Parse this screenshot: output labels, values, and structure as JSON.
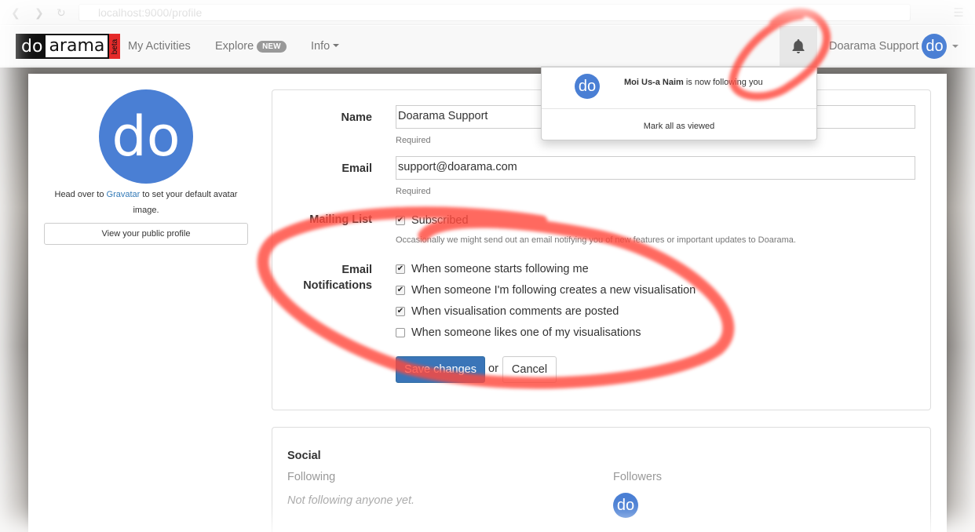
{
  "browser": {
    "url": "localhost:9000/profile"
  },
  "navbar": {
    "logo_left": "do",
    "logo_right": "arama",
    "logo_badge": "beta",
    "links": {
      "my_activities": "My Activities",
      "explore": "Explore",
      "explore_badge": "NEW",
      "info": "Info"
    },
    "user_name": "Doarama Support",
    "user_avatar_text": "do"
  },
  "notifications": {
    "items": [
      {
        "avatar_text": "do",
        "actor": "Moi Us-a Naim",
        "message": " is now following you"
      }
    ],
    "mark_all": "Mark all as viewed"
  },
  "profile": {
    "avatar_text": "do",
    "avatar_hint_before": "Head over to ",
    "avatar_hint_link": "Gravatar",
    "avatar_hint_after": " to set your default avatar image.",
    "public_profile_button": "View your public profile"
  },
  "form": {
    "name_label": "Name",
    "name_value": "Doarama Support",
    "name_help": "Required",
    "email_label": "Email",
    "email_value": "support@doarama.com",
    "email_help": "Required",
    "mailing_label": "Mailing List",
    "mailing_option": "Subscribed",
    "mailing_help": "Occasionally we might send out an email notifying you of new features or important updates to Doarama.",
    "notifications_label_line1": "Email",
    "notifications_label_line2": "Notifications",
    "notification_options": [
      {
        "label": "When someone starts following me",
        "checked": true
      },
      {
        "label": "When someone I'm following creates a new visualisation",
        "checked": true
      },
      {
        "label": "When visualisation comments are posted",
        "checked": true
      },
      {
        "label": "When someone likes one of my visualisations",
        "checked": false
      }
    ],
    "save_button": "Save changes",
    "or_text": "or",
    "cancel_button": "Cancel"
  },
  "social": {
    "title": "Social",
    "following_label": "Following",
    "following_empty": "Not following anyone yet.",
    "followers_label": "Followers",
    "followers": [
      {
        "avatar_text": "do"
      }
    ]
  },
  "colors": {
    "brand_blue": "#4a7fd4",
    "primary_button": "#3a75b8",
    "annotation_red": "#ff4a3d"
  }
}
